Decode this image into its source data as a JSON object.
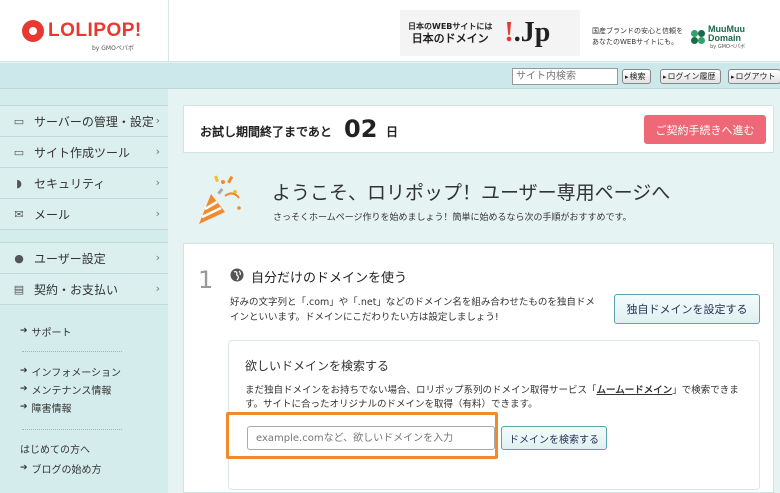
{
  "header": {
    "logo_text": "LOLIPOP!",
    "logo_sub": "by GMOペパボ",
    "banner_jp": {
      "line1": "日本のWEBサイトには",
      "line2": "日本のドメイン",
      "logo": ".Jp"
    },
    "banner_muumuu": {
      "line1": "国産ブランドの安心と信頼を",
      "line2": "あなたのWEBサイトにも。",
      "logo_line1": "MuuMuu",
      "logo_line2": "Domain",
      "logo_sub": "by GMOペパボ"
    }
  },
  "utility": {
    "search_placeholder": "サイト内検索",
    "search_button": "検索",
    "login_history_button": "ログイン履歴",
    "logout_button": "ログアウト"
  },
  "sidebar": {
    "menu1": [
      {
        "label": "サーバーの管理・設定",
        "icon": "server-icon"
      },
      {
        "label": "サイト作成ツール",
        "icon": "laptop-icon"
      },
      {
        "label": "セキュリティ",
        "icon": "shield-icon"
      },
      {
        "label": "メール",
        "icon": "mail-icon"
      }
    ],
    "menu2": [
      {
        "label": "ユーザー設定",
        "icon": "user-icon"
      },
      {
        "label": "契約・お支払い",
        "icon": "card-icon"
      }
    ],
    "links1": [
      "サポート"
    ],
    "links2": [
      "インフォメーション",
      "メンテナンス情報",
      "障害情報"
    ],
    "plain": "はじめての方へ",
    "links3": [
      "ブログの始め方"
    ]
  },
  "trial": {
    "text": "お試し期間終了まであと",
    "days": "02",
    "unit": "日",
    "contract_button": "ご契約手続きへ進む"
  },
  "welcome": {
    "title": "ようこそ、ロリポップ！ユーザー専用ページへ",
    "subtitle": "さっそくホームページ作りを始めましょう！簡単に始めるなら次の手順がおすすめです。"
  },
  "step": {
    "number": "1",
    "title": "自分だけのドメインを使う",
    "description": "好みの文字列と「.com」や「.net」などのドメイン名を組み合わせたものを独自ドメインといいます。ドメインにこだわりたい方は設定しましょう!",
    "set_button": "独自ドメインを設定する",
    "search": {
      "title": "欲しいドメインを検索する",
      "desc_before": "まだ独自ドメインをお持ちでない場合、ロリポップ系列のドメイン取得サービス「",
      "desc_link": "ムームードメイン",
      "desc_after": "」で検索できます。サイトに合ったオリジナルのドメインを取得（有料）できます。",
      "input_placeholder": "example.comなど、欲しいドメインを入力",
      "search_button": "ドメインを検索する"
    }
  },
  "colors": {
    "brand_red": "#e8382f",
    "contract_pink": "#ee6877",
    "highlight_orange": "#f08a2c",
    "sidebar_bg": "#d5ecec"
  }
}
